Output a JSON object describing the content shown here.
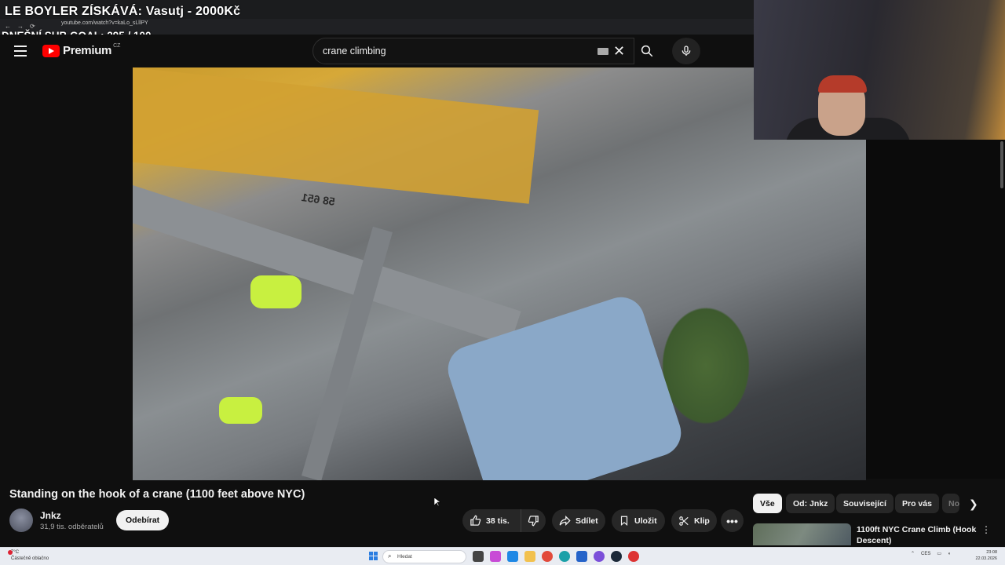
{
  "overlay": {
    "title": "LE BOYLER ZÍSKÁVÁ: Vasutj - 2000Kč",
    "goal": "DNEŠNÍ SUB GOAL:  295 / 100"
  },
  "browser": {
    "url": "youtube.com/watch?v=kaLo_sLllPY",
    "back": "←",
    "forward": "→",
    "reload": "⟳"
  },
  "header": {
    "logo_text": "Premium",
    "country": "CZ",
    "search_value": "crane climbing",
    "clear": "✕"
  },
  "video": {
    "title": "Standing on the hook of a crane (1100 feet above NYC)",
    "scene_marking": "58 651"
  },
  "channel": {
    "name": "Jnkz",
    "subs": "31,9 tis. odběratelů",
    "subscribe_label": "Odebírat"
  },
  "actions": {
    "likes": "38 tis.",
    "share": "Sdílet",
    "save": "Uložit",
    "clip": "Klip",
    "more": "•••"
  },
  "chips": [
    "Vše",
    "Od: Jnkz",
    "Související",
    "Pro vás",
    "No"
  ],
  "recommendation": {
    "title": "1100ft NYC Crane Climb (Hook Descent)",
    "more": "⋮"
  },
  "taskbar": {
    "weather_temp": "7°C",
    "weather_desc": "Částečně oblačno",
    "search_placeholder": "Hledat",
    "lang": "CES",
    "time": "23:08",
    "date": "22.03.2026"
  },
  "colors": {
    "bg": "#0f0f0f",
    "yt_red": "#ff0000",
    "pill": "#272727",
    "text": "#f1f1f1"
  }
}
